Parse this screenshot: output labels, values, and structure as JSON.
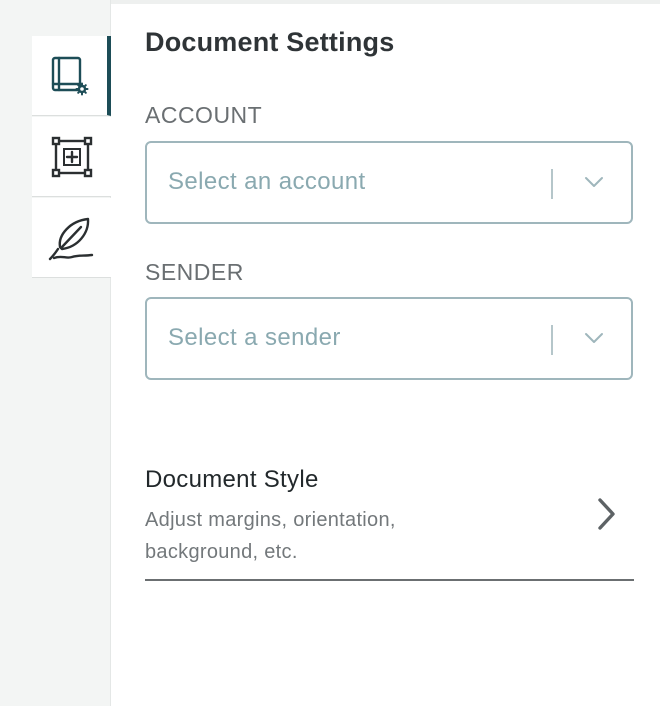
{
  "rail": {
    "tabs": [
      {
        "icon": "document-settings-icon",
        "active": true
      },
      {
        "icon": "add-field-icon",
        "active": false
      },
      {
        "icon": "signature-feather-icon",
        "active": false
      }
    ]
  },
  "panel": {
    "title": "Document Settings",
    "account": {
      "label": "ACCOUNT",
      "placeholder": "Select an account"
    },
    "sender": {
      "label": "SENDER",
      "placeholder": "Select a sender"
    },
    "document_style": {
      "title": "Document Style",
      "description": "Adjust margins, orientation, background, etc."
    }
  },
  "colors": {
    "accent": "#1d4d57",
    "select_border": "#9fb6bc",
    "placeholder": "#8aa9b0"
  }
}
